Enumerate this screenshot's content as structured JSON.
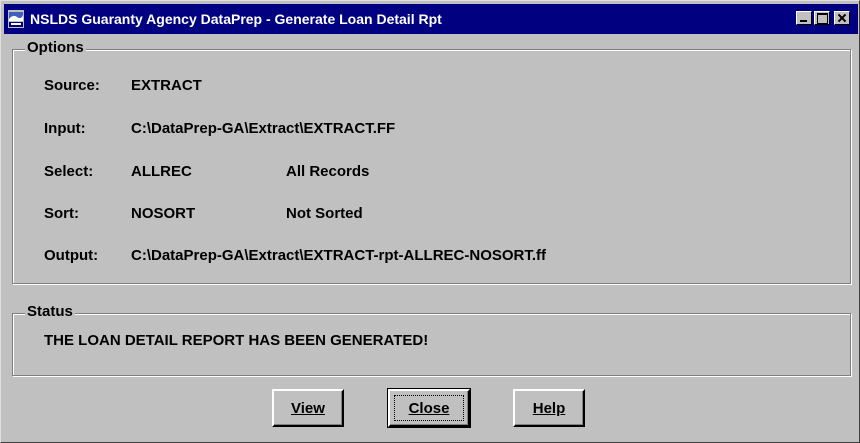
{
  "window": {
    "title": "NSLDS Guaranty Agency DataPrep - Generate Loan Detail Rpt",
    "icon": "nslds-app-icon"
  },
  "options": {
    "legend": "Options",
    "rows": [
      {
        "label": "Source:",
        "value": "EXTRACT",
        "desc": ""
      },
      {
        "label": "Input:",
        "value": "C:\\DataPrep-GA\\Extract\\EXTRACT.FF",
        "desc": ""
      },
      {
        "label": "Select:",
        "value": "ALLREC",
        "desc": "All Records"
      },
      {
        "label": "Sort:",
        "value": "NOSORT",
        "desc": "Not Sorted"
      },
      {
        "label": "Output:",
        "value": "C:\\DataPrep-GA\\Extract\\EXTRACT-rpt-ALLREC-NOSORT.ff",
        "desc": ""
      }
    ]
  },
  "status": {
    "legend": "Status",
    "message": "THE LOAN DETAIL REPORT HAS BEEN GENERATED!"
  },
  "buttons": {
    "view": "View",
    "close": "Close",
    "help": "Help"
  },
  "colors": {
    "titlebar": "#000080",
    "face": "#c0c0c0"
  }
}
